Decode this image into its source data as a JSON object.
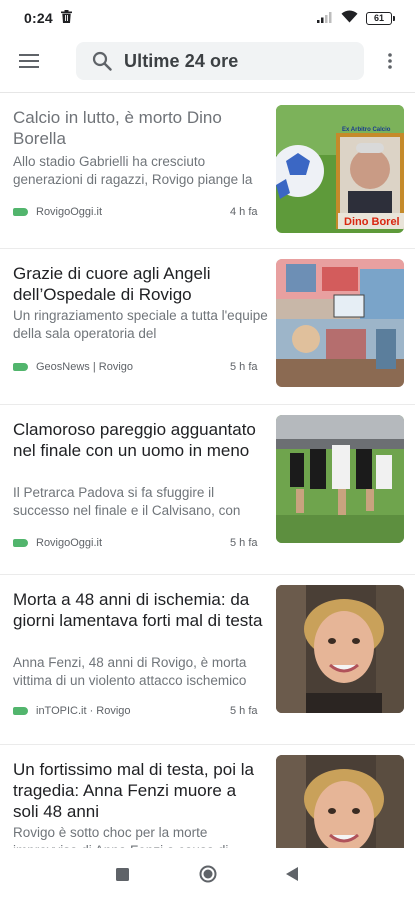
{
  "status_bar": {
    "time": "0:24",
    "battery": "61"
  },
  "search": {
    "query": "Ultime 24 ore"
  },
  "articles": [
    {
      "title": "Calcio in lutto, è morto Dino Borella",
      "snippet": "Allo stadio Gabrielli ha cresciuto generazioni di ragazzi, Rovigo piange la",
      "source": "RovigoOggi.it",
      "age": "4 h fa",
      "thumb_caption": "Dino Borel",
      "thumb_top_text": "Ex Arbitro Calcio"
    },
    {
      "title": "Grazie di cuore agli Angeli dell’Ospedale di Rovigo",
      "snippet": "Un ringraziamento speciale a tutta l'equipe della sala operatoria del",
      "source": "GeosNews | Rovigo",
      "age": "5 h fa"
    },
    {
      "title": "Clamoroso pareggio agguantato nel finale con un uomo in meno",
      "snippet": "Il Petrarca Padova si fa sfuggire il successo nel finale e il Calvisano, con",
      "source": "RovigoOggi.it",
      "age": "5 h fa"
    },
    {
      "title": "Morta a 48 anni di ischemia: da giorni lamentava forti mal di testa",
      "snippet": "Anna Fenzi, 48 anni di Rovigo, è morta vittima di un violento attacco ischemico",
      "source": "inTOPIC.it · Rovigo",
      "age": "5 h fa"
    },
    {
      "title": "Un fortissimo mal di testa, poi la tragedia: Anna Fenzi muore a soli 48 anni",
      "snippet": "Rovigo è sotto choc per la morte improvvisa di Anna Fenzi a causa di",
      "source": "",
      "age": ""
    }
  ],
  "colors": {
    "source_tag": "#34a853",
    "search_bg": "#f1f3f4"
  }
}
